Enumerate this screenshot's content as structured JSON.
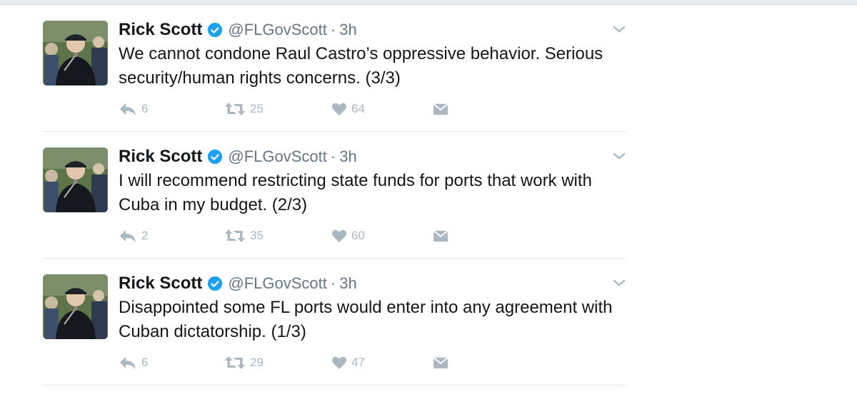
{
  "tweets": [
    {
      "name": "Rick Scott",
      "handle": "@FLGovScott",
      "separator": "·",
      "time": "3h",
      "text": "We cannot condone Raul Castro’s oppressive behavior. Serious security/human rights concerns. (3/3)",
      "replies": "6",
      "retweets": "25",
      "likes": "64"
    },
    {
      "name": "Rick Scott",
      "handle": "@FLGovScott",
      "separator": "·",
      "time": "3h",
      "text": "I will recommend restricting state funds for ports that work with Cuba in my budget. (2/3)",
      "replies": "2",
      "retweets": "35",
      "likes": "60"
    },
    {
      "name": "Rick Scott",
      "handle": "@FLGovScott",
      "separator": "·",
      "time": "3h",
      "text": "Disappointed some FL ports would enter into any agreement with Cuban dictatorship. (1/3)",
      "replies": "6",
      "retweets": "29",
      "likes": "47"
    }
  ],
  "icons": {
    "reply": "reply-icon",
    "retweet": "retweet-icon",
    "like": "heart-icon",
    "dm": "direct-message-icon",
    "verified": "verified-badge-icon",
    "caret": "chevron-down-icon"
  },
  "colors": {
    "verified": "#1da1f2",
    "action": "#aab8c2",
    "secondary_text": "#657786",
    "primary_text": "#14171a"
  }
}
